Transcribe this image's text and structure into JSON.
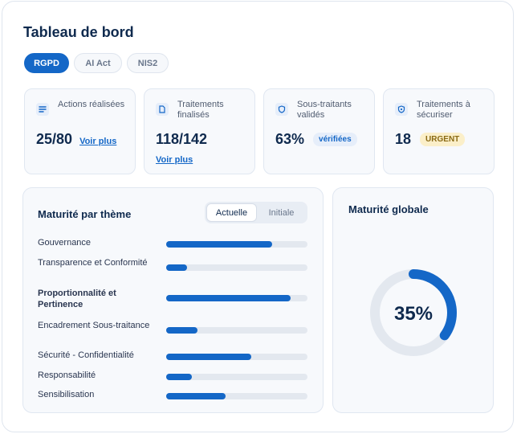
{
  "title": "Tableau de bord",
  "tabs": [
    {
      "label": "RGPD",
      "active": true
    },
    {
      "label": "AI Act",
      "active": false
    },
    {
      "label": "NIS2",
      "active": false
    }
  ],
  "kpis": [
    {
      "icon": "list-icon",
      "label": "Actions réalisées",
      "value": "25/80",
      "link": "Voir plus"
    },
    {
      "icon": "document-icon",
      "label": "Traitements finalisés",
      "value": "118/142",
      "link": "Voir plus"
    },
    {
      "icon": "shield-icon",
      "label": "Sous-traitants validés",
      "value": "63%",
      "badge": "vérifiées"
    },
    {
      "icon": "shield-lock-icon",
      "label": "Traitements à sécuriser",
      "value": "18",
      "badge": "URGENT"
    }
  ],
  "maturity_theme": {
    "title": "Maturité par thème",
    "toggle": [
      "Actuelle",
      "Initiale"
    ],
    "rows": [
      {
        "label": "Gouvernance",
        "value": 0.75
      },
      {
        "label": "Transparence et Conformité",
        "value": 0.15
      },
      {
        "label": "Proportionnalité et Pertinence",
        "value": 0.88
      },
      {
        "label": "Encadrement Sous-traitance",
        "value": 0.22
      },
      {
        "label": "Sécurité - Confidentialité",
        "value": 0.6
      },
      {
        "label": "Responsabilité",
        "value": 0.18
      },
      {
        "label": "Sensibilisation",
        "value": 0.42
      }
    ]
  },
  "maturity_global": {
    "title": "Maturité globale",
    "value": "35%",
    "percent": 35
  },
  "colors": {
    "accent": "#1467c7",
    "track": "#e3e8ef",
    "urgent_bg": "#fbefc9"
  }
}
